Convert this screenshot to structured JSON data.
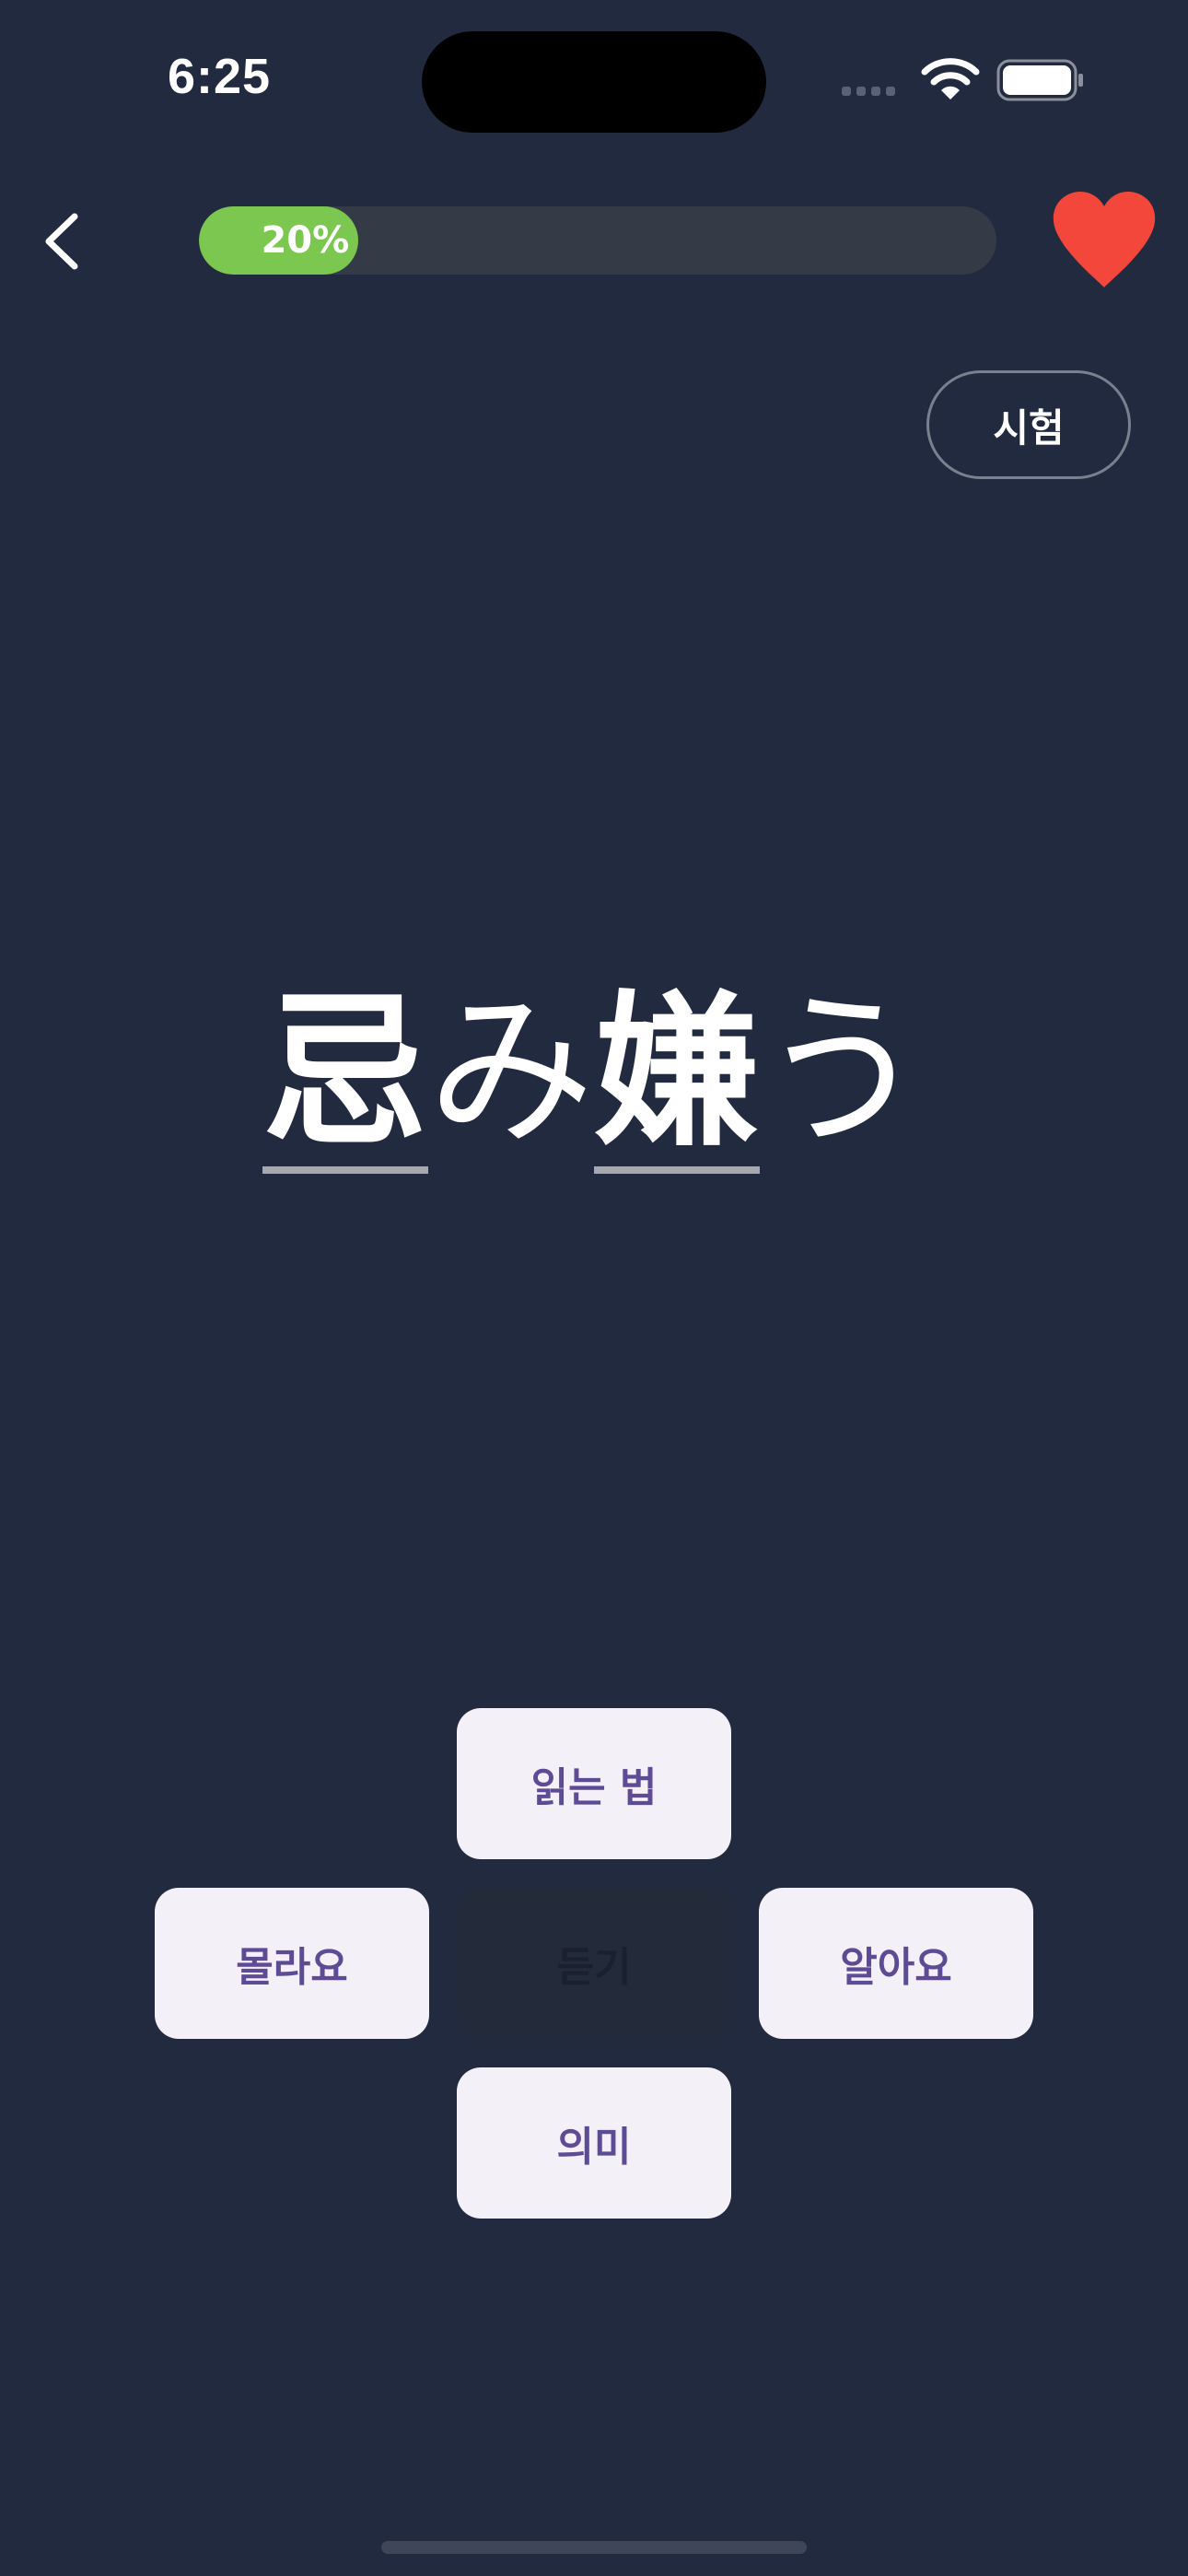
{
  "status_bar": {
    "time": "6:25",
    "icons": [
      "signal-icon",
      "wifi-icon",
      "battery-icon"
    ]
  },
  "header": {
    "back_icon": "chevron-left-icon",
    "progress": {
      "percent": 20,
      "label": "20%"
    },
    "favorite_icon": "heart-icon",
    "favorite_color": "#f2473a"
  },
  "test_button": {
    "label": "시험"
  },
  "word": {
    "chars": [
      "忌",
      "み",
      "嫌",
      "う"
    ]
  },
  "actions": {
    "reading": "읽는 법",
    "dont_know": "몰라요",
    "listen": "듣기",
    "know": "알아요",
    "meaning": "의미"
  },
  "colors": {
    "background": "#212a3e",
    "progress_fill": "#7cc74f",
    "progress_track": "#343b47",
    "button_bg": "#f4f0f8",
    "button_text": "#5e4b96"
  }
}
